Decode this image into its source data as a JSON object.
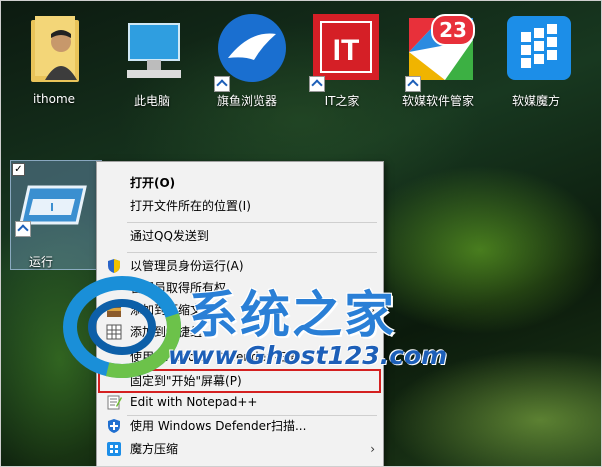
{
  "desktop": {
    "icons": [
      {
        "label": "ithome"
      },
      {
        "label": "此电脑"
      },
      {
        "label": "旗鱼浏览器"
      },
      {
        "label": "IT之家",
        "logo_text": "IT"
      },
      {
        "label": "软媒软件管家",
        "badge": "23"
      },
      {
        "label": "软媒魔方"
      }
    ],
    "selected_icon": {
      "label": "运行",
      "checkbox": "✓"
    }
  },
  "context_menu": {
    "items": [
      {
        "label": "打开(O)",
        "bold": true
      },
      {
        "label": "打开文件所在的位置(I)"
      },
      {
        "label": "通过QQ发送到"
      },
      {
        "label": "以管理员身份运行(A)",
        "icon": "uac-shield-icon"
      },
      {
        "label": "管理员取得所有权",
        "icon": "key-icon"
      },
      {
        "label": "添加到压缩文件",
        "icon": "archive-icon"
      },
      {
        "label": "添加到快捷组",
        "icon": "grid-icon"
      },
      {
        "label": "使用 Windows Defender 扫描",
        "icon": "defender-icon"
      },
      {
        "label": "固定到\"开始\"屏幕(P)"
      },
      {
        "label": "Edit with Notepad++",
        "icon": "notepad-icon"
      },
      {
        "label": "使用 Windows Defender扫描...",
        "icon": "defender-icon"
      },
      {
        "label": "魔方压缩",
        "icon": "cube-icon"
      }
    ],
    "submenu_arrow": "›"
  },
  "watermark": {
    "title": "系统之家",
    "url": "www.Ghost123.com"
  },
  "colors": {
    "highlight_border": "#d42020",
    "ithome_red": "#d51f26",
    "browser_blue": "#1a6fd0",
    "badge_red": "#e8303a",
    "cube_blue": "#1c8ee8"
  }
}
